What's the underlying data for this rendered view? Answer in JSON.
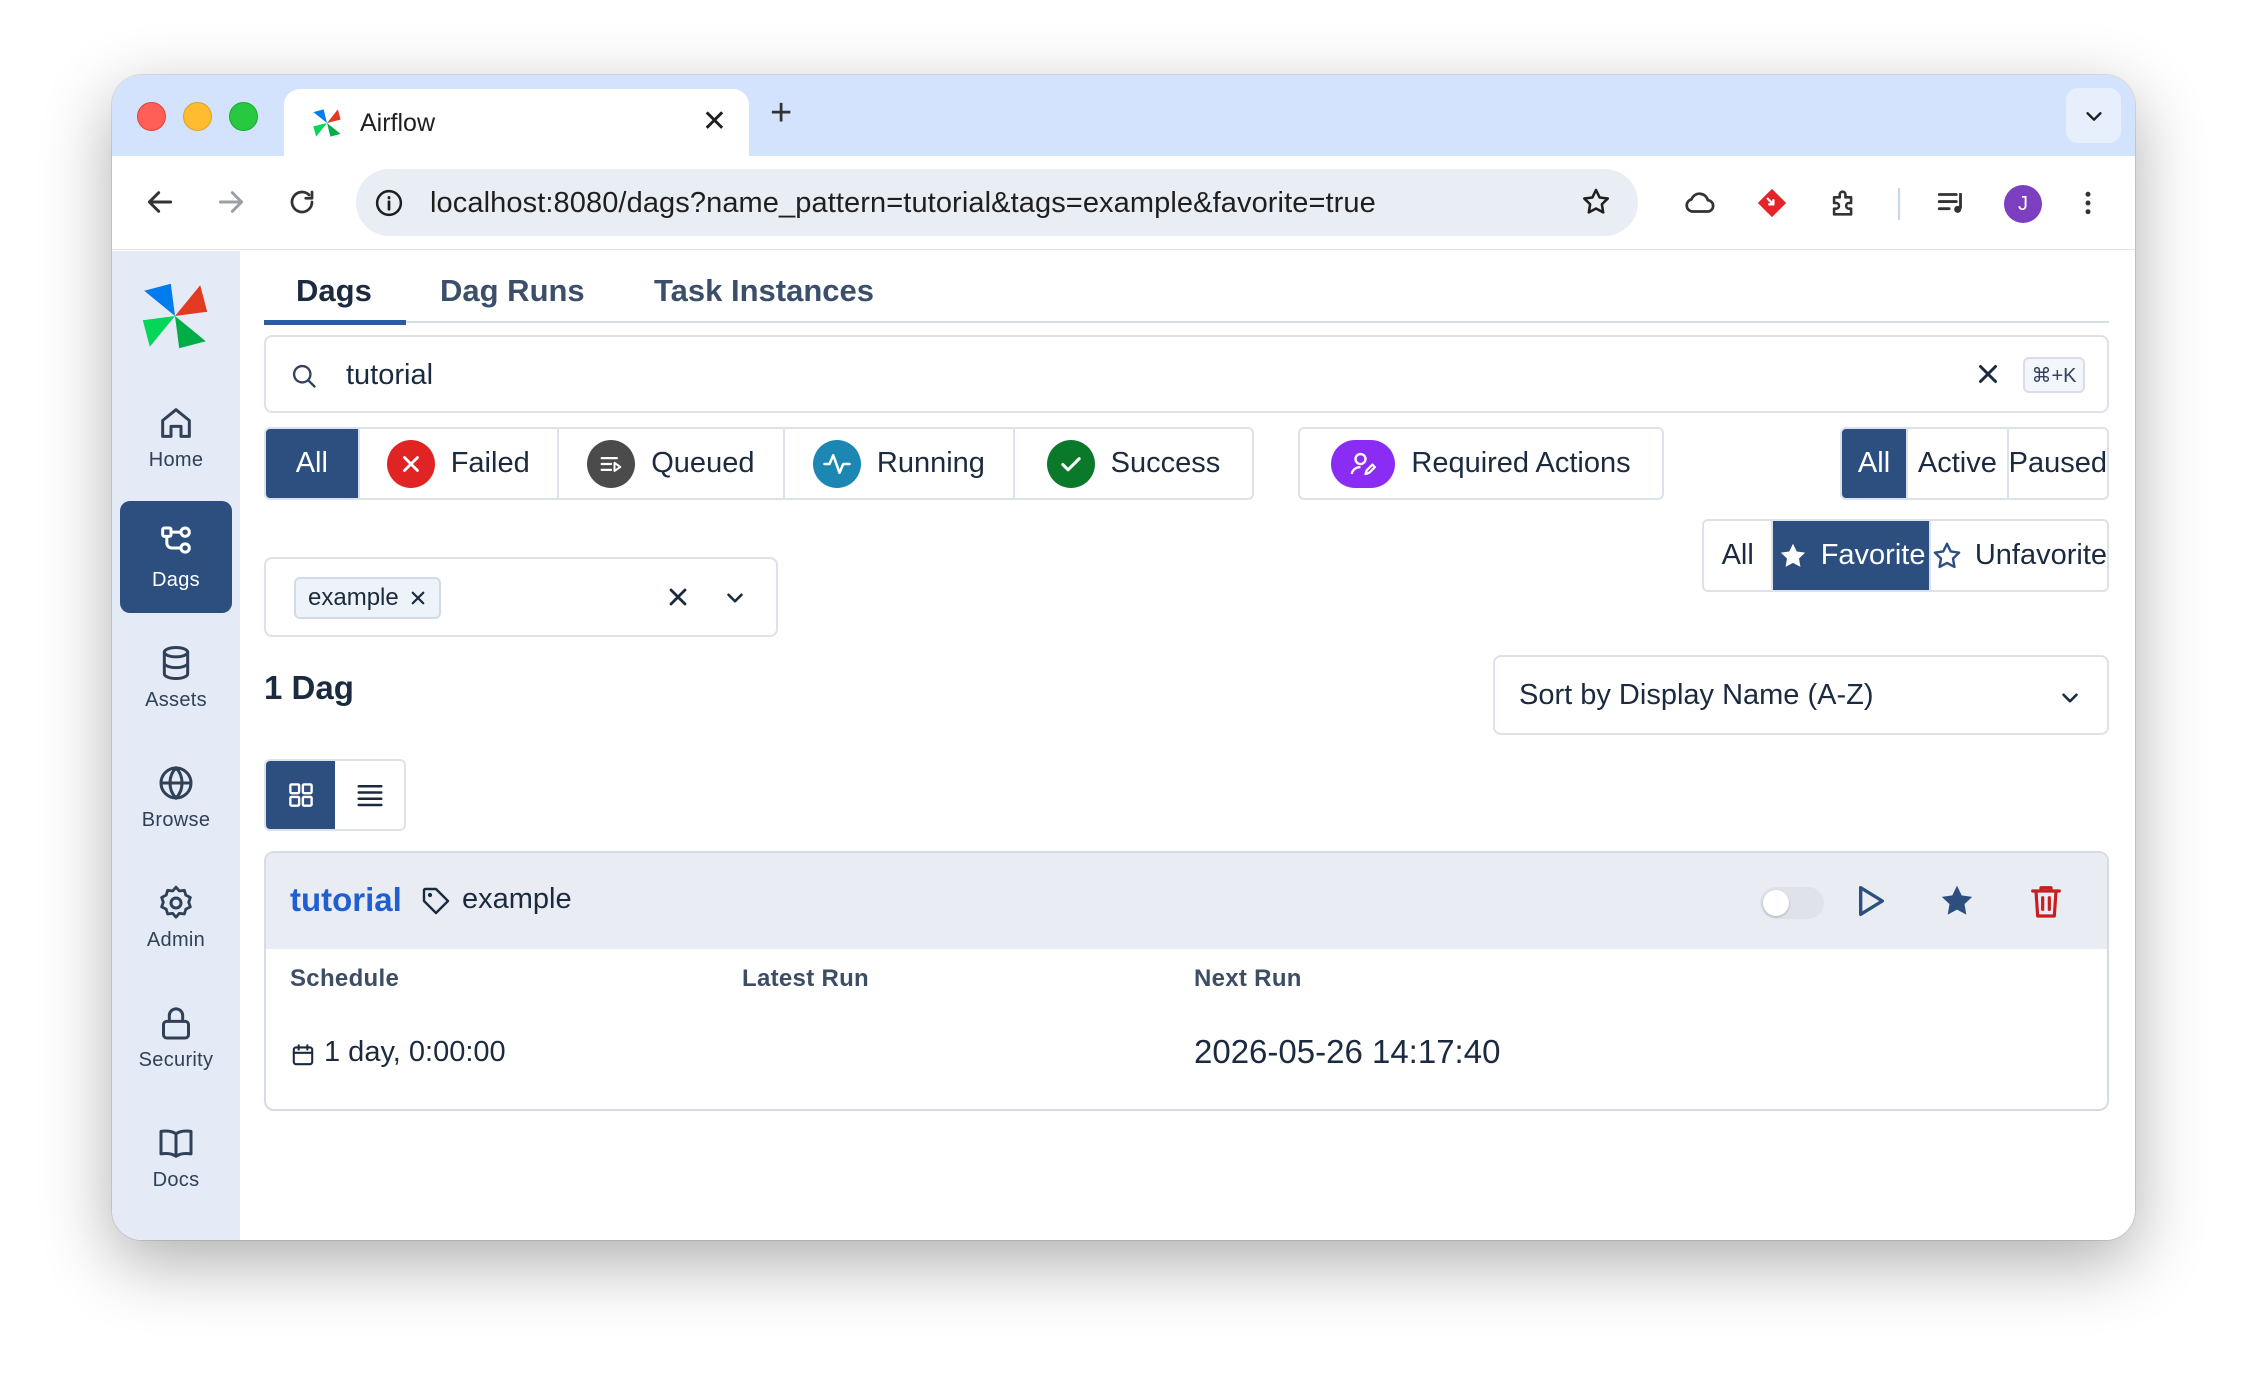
{
  "browser": {
    "tab_title": "Airflow",
    "url": "localhost:8080/dags?name_pattern=tutorial&tags=example&favorite=true",
    "avatar_initial": "J"
  },
  "sidebar": {
    "items": [
      {
        "label": "Home",
        "icon": "home-icon"
      },
      {
        "label": "Dags",
        "icon": "dags-icon",
        "active": true
      },
      {
        "label": "Assets",
        "icon": "database-icon"
      },
      {
        "label": "Browse",
        "icon": "globe-icon"
      },
      {
        "label": "Admin",
        "icon": "gear-icon"
      },
      {
        "label": "Security",
        "icon": "lock-icon"
      },
      {
        "label": "Docs",
        "icon": "book-icon"
      }
    ]
  },
  "page_tabs": [
    "Dags",
    "Dag Runs",
    "Task Instances"
  ],
  "search": {
    "value": "tutorial",
    "shortcut": "⌘+K"
  },
  "state_filters": {
    "all": "All",
    "failed": "Failed",
    "queued": "Queued",
    "running": "Running",
    "success": "Success"
  },
  "required_actions": "Required Actions",
  "active_filters": {
    "all": "All",
    "active": "Active",
    "paused": "Paused"
  },
  "favorite_filters": {
    "all": "All",
    "favorite": "Favorite",
    "unfavorite": "Unfavorite"
  },
  "tag_filter": {
    "chip": "example"
  },
  "dag_count": "1 Dag",
  "sort": {
    "label": "Sort by Display Name (A-Z)"
  },
  "dag_card": {
    "name": "tutorial",
    "tag": "example",
    "paused": true,
    "columns": {
      "schedule": "Schedule",
      "latest_run": "Latest Run",
      "next_run": "Next Run"
    },
    "schedule_value": "1 day, 0:00:00",
    "latest_run_value": "",
    "next_run_value": "2026-05-26 14:17:40"
  },
  "colors": {
    "primary": "#2c4f80",
    "failed": "#e02424",
    "queued": "#4b4b4b",
    "running": "#1c87b3",
    "success": "#0a7a2a",
    "required": "#8b2cf5",
    "link": "#1f5fd1",
    "delete": "#c81e1e"
  }
}
